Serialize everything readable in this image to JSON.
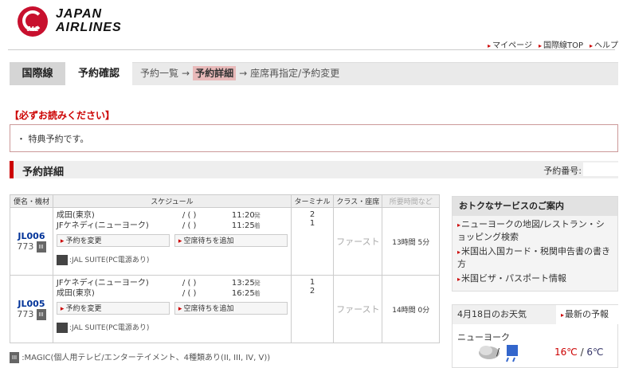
{
  "brand": {
    "line1": "JAPAN",
    "line2": "AIRLINES",
    "logo_text": "JAL"
  },
  "top_links": [
    "マイページ",
    "国際線TOP",
    "ヘルプ"
  ],
  "nav": {
    "tab1": "国際線",
    "tab2": "予約確認",
    "crumb1": "予約一覧",
    "arrow": "→",
    "crumb_current": "予約詳細",
    "crumb3": "座席再指定/予約変更"
  },
  "notice": {
    "title": "【必ずお読みください】",
    "body": "・ 特典予約です。"
  },
  "section": {
    "title": "予約詳細",
    "res_label": "予約番号:"
  },
  "itinerary": {
    "headers": [
      "便名・機材",
      "スケジュール",
      "ターミナル",
      "クラス・座席",
      "所要時間など"
    ],
    "flights": [
      {
        "flight": "JL006",
        "aircraft": "773",
        "magic": "III",
        "seg1_city": "成田(東京)",
        "seg1_date": "/ ( )",
        "seg1_time": "11:20",
        "seg1_mark": "発",
        "seg1_term": "2",
        "seg2_city": "JFケネディ(ニューヨーク)",
        "seg2_date": "/ ( )",
        "seg2_time": "11:25",
        "seg2_mark": "着",
        "seg2_term": "1",
        "btn_change": "予約を変更",
        "btn_wait": "空席待ちを追加",
        "suite": ":JAL SUITE(PC電源あり)",
        "class": "ファースト",
        "duration": "13時間 5分"
      },
      {
        "flight": "JL005",
        "aircraft": "773",
        "magic": "III",
        "seg1_city": "JFケネディ(ニューヨーク)",
        "seg1_date": "/ ( )",
        "seg1_time": "13:25",
        "seg1_mark": "発",
        "seg1_term": "1",
        "seg2_city": "成田(東京)",
        "seg2_date": "/ ( )",
        "seg2_time": "16:25",
        "seg2_mark": "着",
        "seg2_term": "2",
        "btn_change": "予約を変更",
        "btn_wait": "空席待ちを追加",
        "suite": ":JAL SUITE(PC電源あり)",
        "class": "ファースト",
        "duration": "14時間 0分"
      }
    ]
  },
  "footnote": ":MAGIC(個人用テレビ/エンターテイメント、4種類あり(II, III, IV, V))",
  "sidebar": {
    "title": "おトクなサービスのご案内",
    "links": [
      "ニューヨークの地図/レストラン・ショッピング検索",
      "米国出入国カード・税関申告書の書き方",
      "米国ビザ・パスポート情報"
    ]
  },
  "weather": {
    "tab1": "4月18日のお天気",
    "tab2": "最新の予報",
    "city": "ニューヨーク",
    "high": "16℃",
    "sep": " / ",
    "low": "6℃"
  },
  "colors": {
    "accent": "#c00",
    "brand": "#c8102e"
  }
}
